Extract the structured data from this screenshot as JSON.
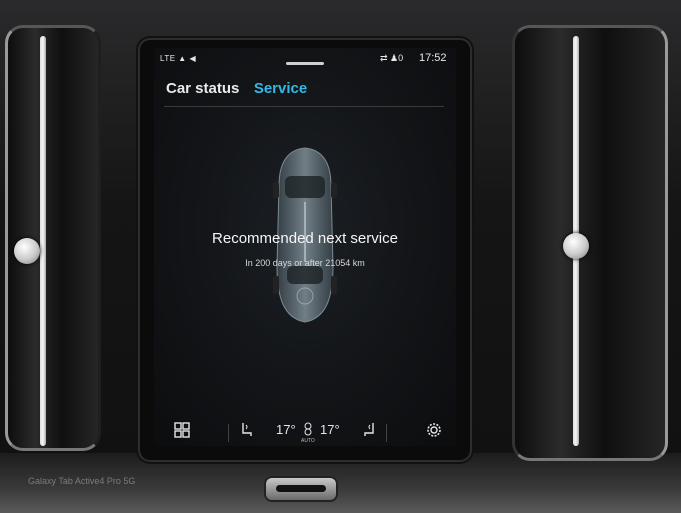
{
  "statusbar": {
    "left_icons": "LTE ▲ ◀",
    "right_icons": "⇄ ♟0",
    "time": "17:52"
  },
  "tabs": [
    {
      "label": "Car status",
      "active": false
    },
    {
      "label": "Service",
      "active": true
    }
  ],
  "service": {
    "title": "Recommended next service",
    "subtitle": "In 200 days or after 21054 km"
  },
  "climate": {
    "left_temp": "17°",
    "right_temp": "17°",
    "fan_mode": "AUTO"
  },
  "bottom_icons": {
    "home": "grid-icon",
    "driver_seat": "seat-heat-icon",
    "fan": "fan-icon",
    "passenger_seat": "seat-heat-icon",
    "settings": "gear-icon"
  },
  "watermark": "Galaxy Tab Active4 Pro 5G",
  "colors": {
    "accent": "#35b7e6",
    "screen_bg": "#121417",
    "text": "#f5f5f5"
  }
}
